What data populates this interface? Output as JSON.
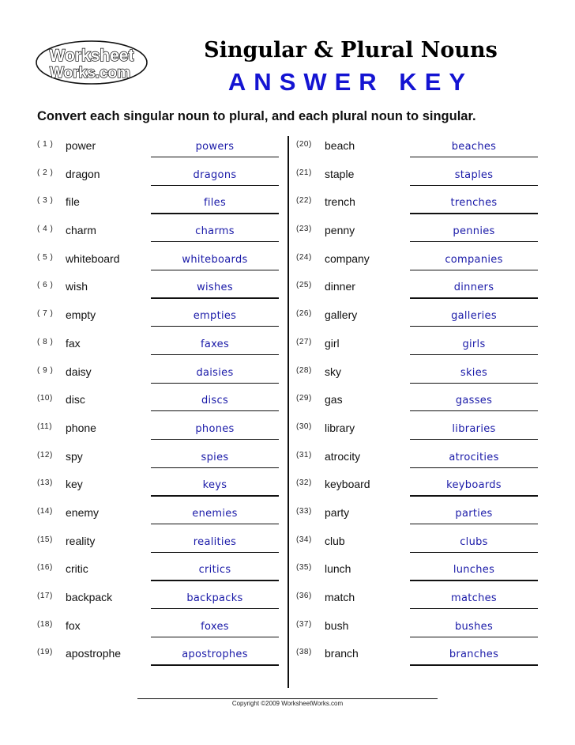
{
  "header": {
    "logo_line1": "Worksheet",
    "logo_line2": "Works.com",
    "title": "Singular & Plural Nouns",
    "subtitle": "ANSWER KEY"
  },
  "instructions": "Convert each singular noun to plural, and each plural noun to singular.",
  "colors": {
    "answer": "#1a1aa8",
    "subtitle": "#1414d2"
  },
  "left_column": [
    {
      "num": "( 1 )",
      "word": "power",
      "answer": "powers"
    },
    {
      "num": "( 2 )",
      "word": "dragon",
      "answer": "dragons"
    },
    {
      "num": "( 3 )",
      "word": "file",
      "answer": "files"
    },
    {
      "num": "( 4 )",
      "word": "charm",
      "answer": "charms"
    },
    {
      "num": "( 5 )",
      "word": "whiteboard",
      "answer": "whiteboards"
    },
    {
      "num": "( 6 )",
      "word": "wish",
      "answer": "wishes"
    },
    {
      "num": "( 7 )",
      "word": "empty",
      "answer": "empties"
    },
    {
      "num": "( 8 )",
      "word": "fax",
      "answer": "faxes"
    },
    {
      "num": "( 9 )",
      "word": "daisy",
      "answer": "daisies"
    },
    {
      "num": "(10)",
      "word": "disc",
      "answer": "discs"
    },
    {
      "num": "(11)",
      "word": "phone",
      "answer": "phones"
    },
    {
      "num": "(12)",
      "word": "spy",
      "answer": "spies"
    },
    {
      "num": "(13)",
      "word": "key",
      "answer": "keys"
    },
    {
      "num": "(14)",
      "word": "enemy",
      "answer": "enemies"
    },
    {
      "num": "(15)",
      "word": "reality",
      "answer": "realities"
    },
    {
      "num": "(16)",
      "word": "critic",
      "answer": "critics"
    },
    {
      "num": "(17)",
      "word": "backpack",
      "answer": "backpacks"
    },
    {
      "num": "(18)",
      "word": "fox",
      "answer": "foxes"
    },
    {
      "num": "(19)",
      "word": "apostrophe",
      "answer": "apostrophes"
    }
  ],
  "right_column": [
    {
      "num": "(20)",
      "word": "beach",
      "answer": "beaches"
    },
    {
      "num": "(21)",
      "word": "staple",
      "answer": "staples"
    },
    {
      "num": "(22)",
      "word": "trench",
      "answer": "trenches"
    },
    {
      "num": "(23)",
      "word": "penny",
      "answer": "pennies"
    },
    {
      "num": "(24)",
      "word": "company",
      "answer": "companies"
    },
    {
      "num": "(25)",
      "word": "dinner",
      "answer": "dinners"
    },
    {
      "num": "(26)",
      "word": "gallery",
      "answer": "galleries"
    },
    {
      "num": "(27)",
      "word": "girl",
      "answer": "girls"
    },
    {
      "num": "(28)",
      "word": "sky",
      "answer": "skies"
    },
    {
      "num": "(29)",
      "word": "gas",
      "answer": "gasses"
    },
    {
      "num": "(30)",
      "word": "library",
      "answer": "libraries"
    },
    {
      "num": "(31)",
      "word": "atrocity",
      "answer": "atrocities"
    },
    {
      "num": "(32)",
      "word": "keyboard",
      "answer": "keyboards"
    },
    {
      "num": "(33)",
      "word": "party",
      "answer": "parties"
    },
    {
      "num": "(34)",
      "word": "club",
      "answer": "clubs"
    },
    {
      "num": "(35)",
      "word": "lunch",
      "answer": "lunches"
    },
    {
      "num": "(36)",
      "word": "match",
      "answer": "matches"
    },
    {
      "num": "(37)",
      "word": "bush",
      "answer": "bushes"
    },
    {
      "num": "(38)",
      "word": "branch",
      "answer": "branches"
    }
  ],
  "footer": {
    "copyright": "Copyright ©2009 WorksheetWorks.com"
  }
}
